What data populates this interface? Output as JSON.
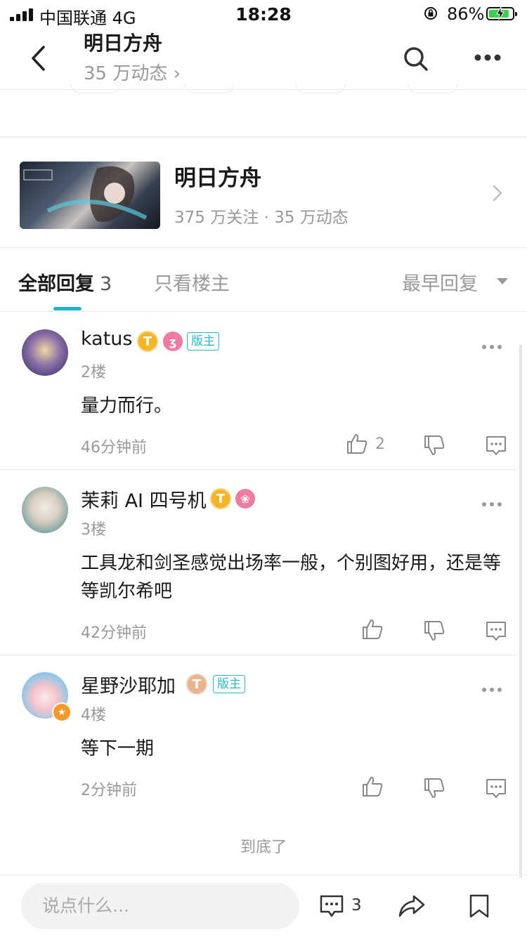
{
  "status_bar": {
    "carrier": "中国联通  4G",
    "time": "18:28",
    "battery_pct": "86%"
  },
  "nav": {
    "title": "明日方舟",
    "subtitle": "35 万动态 ›"
  },
  "forum_card": {
    "title": "明日方舟",
    "stats": "375 万关注 · 35 万动态"
  },
  "tabs": {
    "all_label": "全部回复",
    "all_count": "3",
    "op_only": "只看楼主",
    "sort_label": "最早回复"
  },
  "comments": [
    {
      "name": "katus",
      "level": "T",
      "mod_tag": "版主",
      "floor": "2楼",
      "text": "量力而行。",
      "time": "46分钟前",
      "likes": "2"
    },
    {
      "name": "茉莉 AI 四号机",
      "level": "T",
      "floor": "3楼",
      "text": "工具龙和剑圣感觉出场率一般，个别图好用，还是等等凯尔希吧",
      "time": "42分钟前",
      "likes": ""
    },
    {
      "name": "星野沙耶加",
      "level": "T",
      "mod_tag": "版主",
      "floor": "4楼",
      "text": "等下一期",
      "time": "2分钟前",
      "likes": ""
    }
  ],
  "end_text": "到底了",
  "bottom_bar": {
    "placeholder": "说点什么...",
    "comment_count": "3"
  },
  "colors": {
    "accent": "#1db5c4",
    "mod_tag": "#2bb7c7",
    "level_gold": "#f5b52a",
    "muted": "#999999"
  }
}
